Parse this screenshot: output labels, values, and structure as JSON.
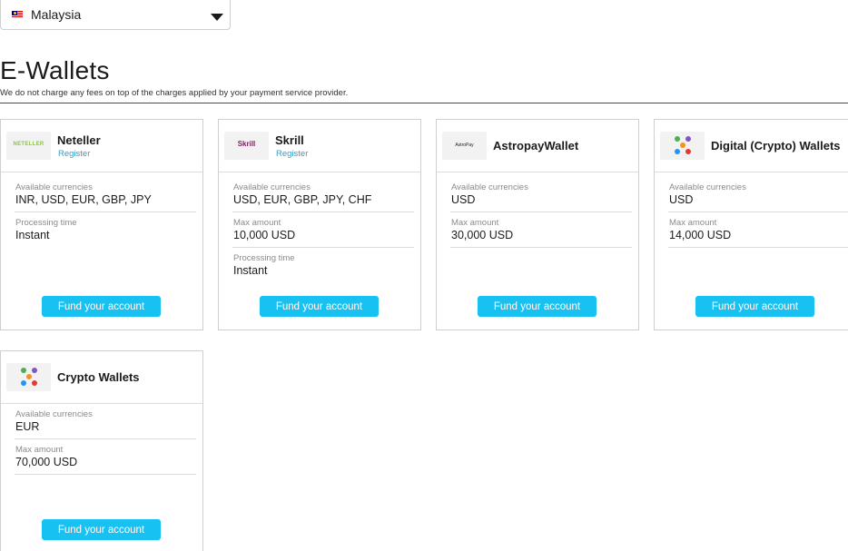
{
  "country_select": {
    "value": "Malaysia"
  },
  "section": {
    "title": "E-Wallets",
    "subtitle": "We do not charge any fees on top of the charges applied by your payment service provider."
  },
  "cards": [
    {
      "name": "Neteller",
      "logo_text": "NETELLER",
      "register_label": "Register",
      "fields": [
        {
          "label": "Available currencies",
          "value": "INR, USD, EUR, GBP, JPY"
        },
        {
          "label": "Processing time",
          "value": "Instant"
        }
      ],
      "button_label": "Fund your account"
    },
    {
      "name": "Skrill",
      "logo_text": "Skrill",
      "register_label": "Register",
      "fields": [
        {
          "label": "Available currencies",
          "value": "USD, EUR, GBP, JPY, CHF"
        },
        {
          "label": "Max amount",
          "value": "10,000 USD"
        },
        {
          "label": "Processing time",
          "value": "Instant"
        }
      ],
      "button_label": "Fund your account"
    },
    {
      "name": "AstropayWallet",
      "logo_text": "AstroPay",
      "fields": [
        {
          "label": "Available currencies",
          "value": "USD"
        },
        {
          "label": "Max amount",
          "value": "30,000 USD"
        }
      ],
      "button_label": "Fund your account"
    },
    {
      "name": "Digital (Crypto) Wallets",
      "logo_icon": "crypto-coins-icon",
      "fields": [
        {
          "label": "Available currencies",
          "value": "USD"
        },
        {
          "label": "Max amount",
          "value": "14,000 USD"
        }
      ],
      "button_label": "Fund your account"
    },
    {
      "name": "Crypto Wallets",
      "logo_icon": "crypto-coins-icon",
      "fields": [
        {
          "label": "Available currencies",
          "value": "EUR"
        },
        {
          "label": "Max amount",
          "value": "70,000 USD"
        }
      ],
      "button_label": "Fund your account"
    }
  ],
  "colors": {
    "accent_button": "#17c1f1",
    "link": "#1aa7d6",
    "neteller_green": "#8dc63f",
    "skrill_purple": "#862165"
  }
}
